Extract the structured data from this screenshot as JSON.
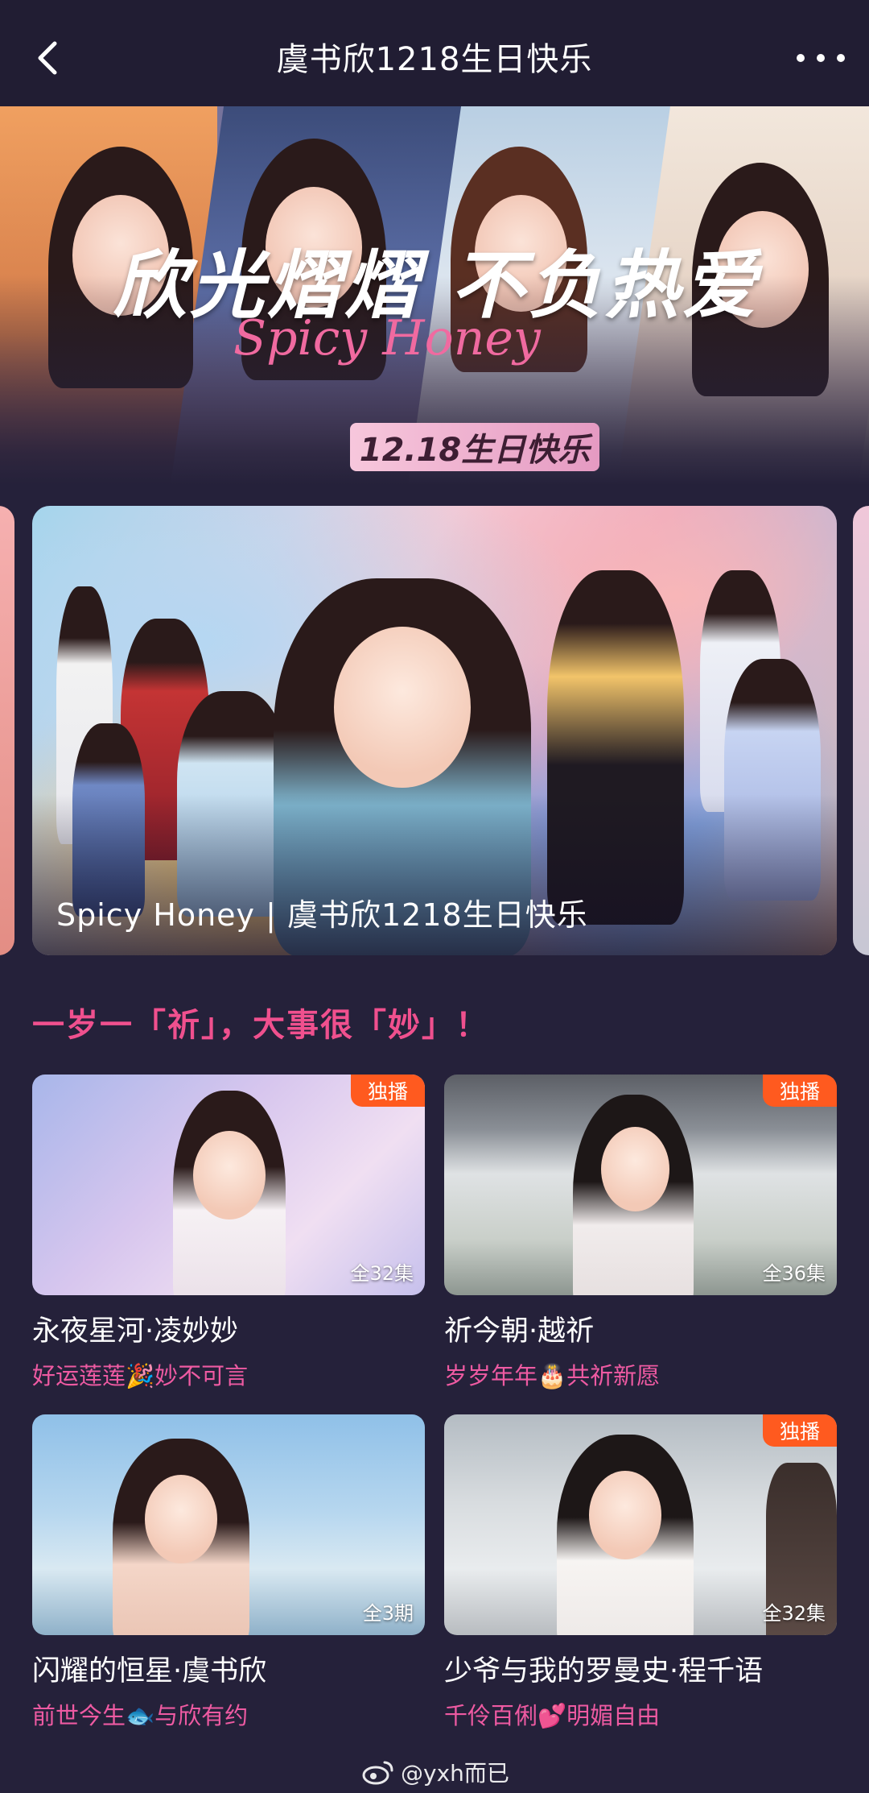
{
  "header": {
    "title": "虞书欣1218生日快乐"
  },
  "hero": {
    "slogan": "欣光熠熠 不负热爱",
    "brand": "Spicy Honey",
    "date": "12.18生日快乐"
  },
  "carousel": {
    "caption": "Spicy Honey | 虞书欣1218生日快乐"
  },
  "section": {
    "title": "一岁一「祈」，大事很「妙」！"
  },
  "cards": [
    {
      "badge": "独播",
      "count": "全32集",
      "title": "永夜星河·凌妙妙",
      "subtitle": "好运莲莲🎉妙不可言"
    },
    {
      "badge": "独播",
      "count": "全36集",
      "title": "祈今朝·越祈",
      "subtitle": "岁岁年年🎂共祈新愿"
    },
    {
      "badge": "",
      "count": "全3期",
      "title": "闪耀的恒星·虞书欣",
      "subtitle": "前世今生🐟与欣有约"
    },
    {
      "badge": "独播",
      "count": "全32集",
      "title": "少爷与我的罗曼史·程千语",
      "subtitle": "千伶百俐💕明媚自由"
    }
  ],
  "watermark": {
    "text": "@yxh而已"
  },
  "colors": {
    "background": "#25213a",
    "accent_pink": "#f0508e",
    "badge_orange": "#ff5a1f"
  }
}
